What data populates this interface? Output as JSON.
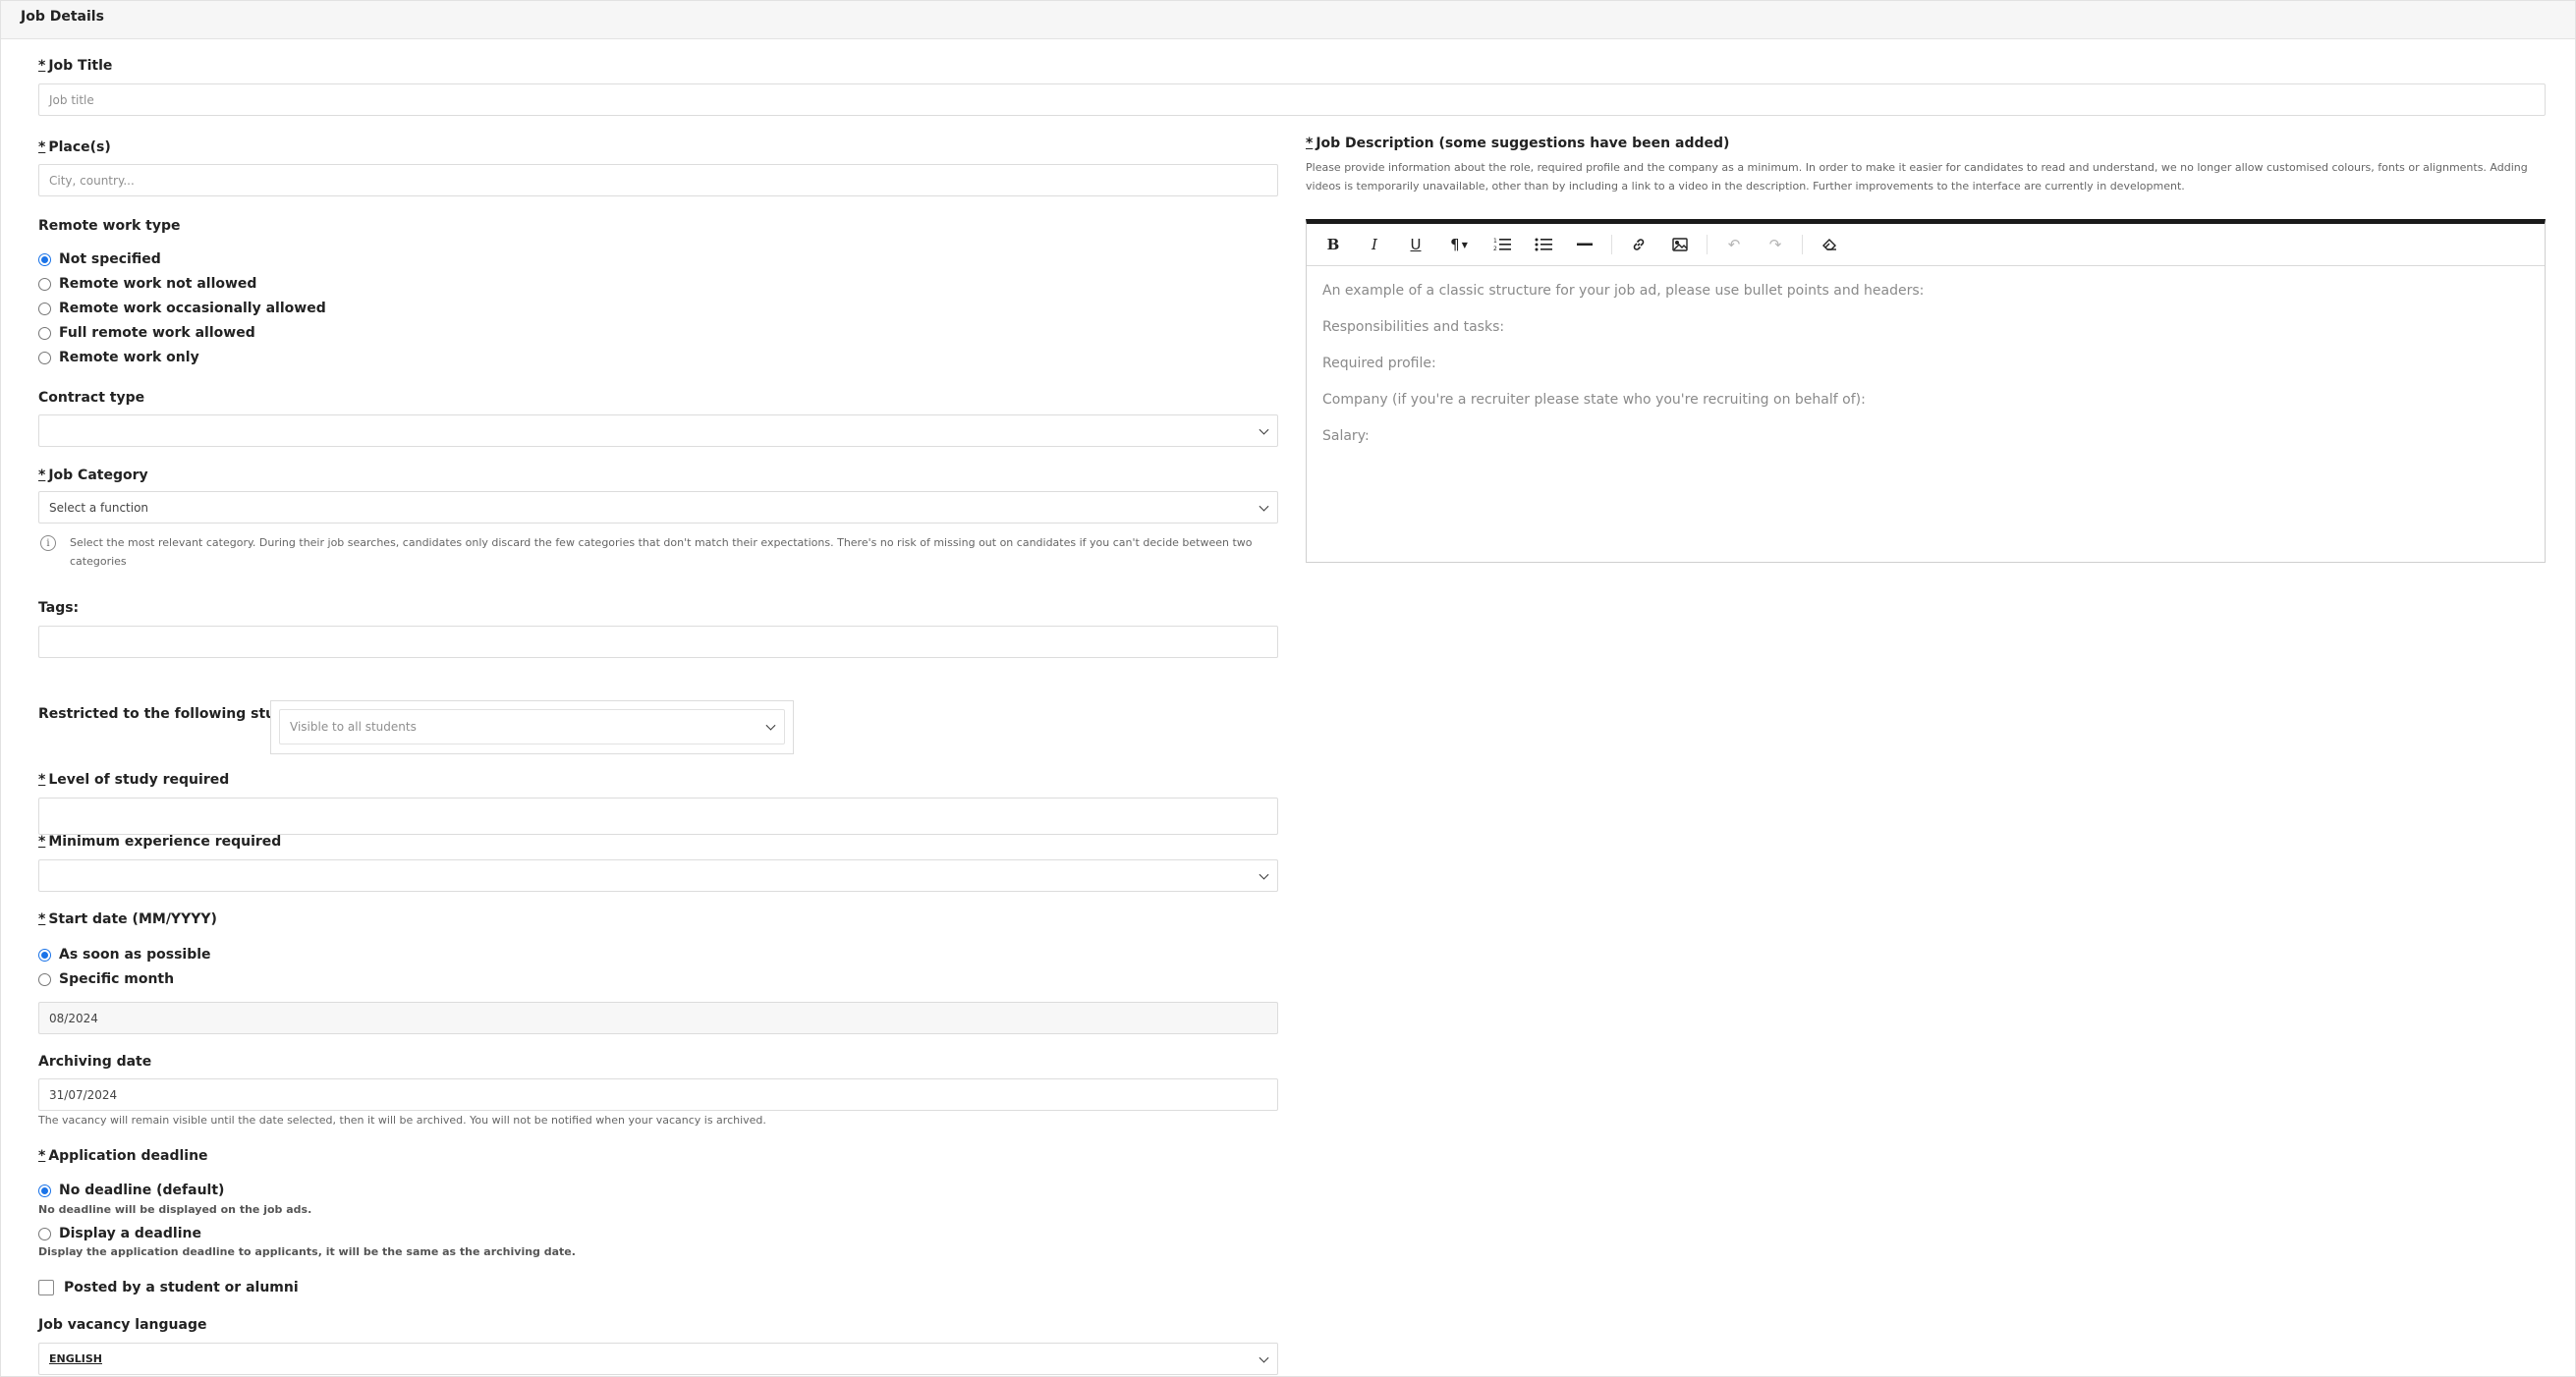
{
  "panel": {
    "title": "Job Details"
  },
  "job_title": {
    "label": "Job Title",
    "placeholder": "Job title"
  },
  "places": {
    "label": "Place(s)",
    "placeholder": "City, country..."
  },
  "remote": {
    "label": "Remote work type",
    "options": [
      "Not specified",
      "Remote work not allowed",
      "Remote work occasionally allowed",
      "Full remote work allowed",
      "Remote work only"
    ],
    "selected": "Not specified"
  },
  "contract": {
    "label": "Contract type",
    "value": ""
  },
  "category": {
    "label": "Job Category",
    "value": "Select a function",
    "help": "Select the most relevant category. During their job searches, candidates only discard the few categories that don't match their expectations. There's no risk of missing out on candidates if you can't decide between two categories"
  },
  "tags": {
    "label": "Tags:",
    "value": ""
  },
  "restricted": {
    "label": "Restricted to the following students",
    "value": "Visible to all students"
  },
  "study_level": {
    "label": "Level of study required",
    "value": ""
  },
  "experience": {
    "label": "Minimum experience required",
    "value": ""
  },
  "start_date": {
    "label": "Start date (MM/YYYY)",
    "options": [
      "As soon as possible",
      "Specific month"
    ],
    "selected": "As soon as possible",
    "value": "08/2024"
  },
  "archiving": {
    "label": "Archiving date",
    "value": "31/07/2024",
    "help": "The vacancy will remain visible until the date selected, then it will be archived. You will not be notified when your vacancy is archived."
  },
  "deadline": {
    "label": "Application deadline",
    "options": [
      {
        "label": "No deadline (default)",
        "help": "No deadline will be displayed on the job ads."
      },
      {
        "label": "Display a deadline",
        "help": "Display the application deadline to applicants, it will be the same as the archiving date."
      }
    ],
    "selected": "No deadline (default)"
  },
  "posted_by_student": {
    "label": "Posted by a student or alumni",
    "checked": false
  },
  "language": {
    "label": "Job vacancy language",
    "value": "ENGLISH"
  },
  "description": {
    "label": "Job Description (some suggestions have been added)",
    "help": "Please provide information about the role, required profile and the company as a minimum. In order to make it easier for candidates to read and understand, we no longer allow customised colours, fonts or alignments. Adding videos is temporarily unavailable, other than by including a link to a video in the description. Further improvements to the interface are currently in development.",
    "toolbar": [
      "bold-icon",
      "italic-icon",
      "underline-icon",
      "paragraph-format-icon",
      "ordered-list-icon",
      "bullet-list-icon",
      "horizontal-rule-icon",
      "link-icon",
      "image-icon",
      "undo-icon",
      "redo-icon",
      "clear-format-icon"
    ],
    "lines": [
      "An example of a classic structure for your job ad, please use bullet points and headers:",
      "Responsibilities and tasks:",
      "Required profile:",
      "Company (if you're a recruiter please state who you're recruiting on behalf of):",
      "Salary:"
    ]
  },
  "colors": {
    "accent": "#1a73e8",
    "border": "#dcdcdc",
    "header_bg": "#f6f6f6"
  }
}
